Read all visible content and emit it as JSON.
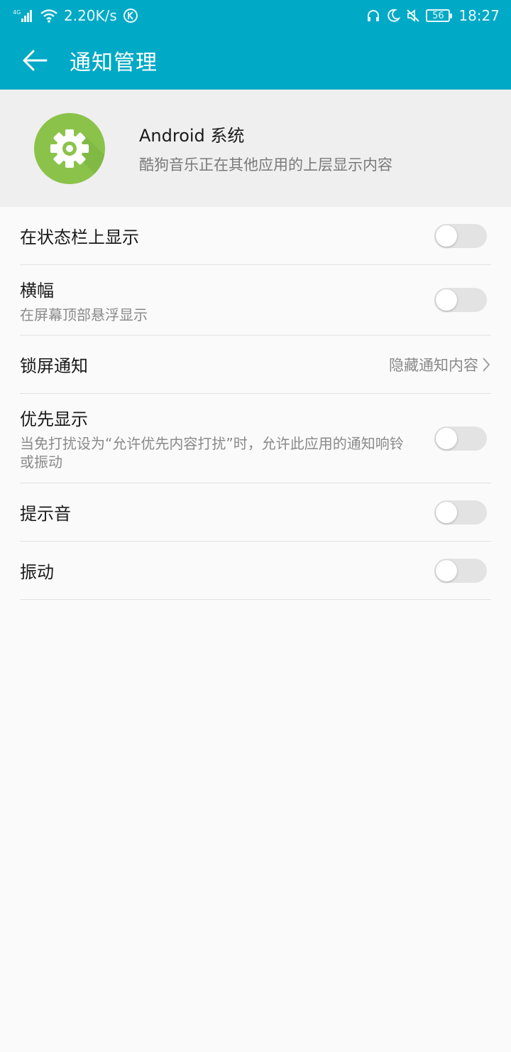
{
  "status_bar": {
    "network": "4G",
    "speed": "2.20K/s",
    "battery": "56",
    "time": "18:27"
  },
  "app_bar": {
    "title": "通知管理"
  },
  "app_header": {
    "name": "Android 系统",
    "description": "酷狗音乐正在其他应用的上层显示内容",
    "icon": "gear-icon",
    "icon_color": "#8bc34a"
  },
  "settings": {
    "status_bar_display": {
      "title": "在状态栏上显示",
      "enabled": false
    },
    "banner": {
      "title": "横幅",
      "subtitle": "在屏幕顶部悬浮显示",
      "enabled": false
    },
    "lock_screen": {
      "title": "锁屏通知",
      "value": "隐藏通知内容"
    },
    "priority": {
      "title": "优先显示",
      "subtitle": "当免打扰设为“允许优先内容打扰”时，允许此应用的通知响铃或振动",
      "enabled": false
    },
    "sound": {
      "title": "提示音",
      "enabled": false
    },
    "vibrate": {
      "title": "振动",
      "enabled": false
    }
  },
  "colors": {
    "accent": "#00a9c5",
    "toggle_off": "#e3e3e3"
  }
}
